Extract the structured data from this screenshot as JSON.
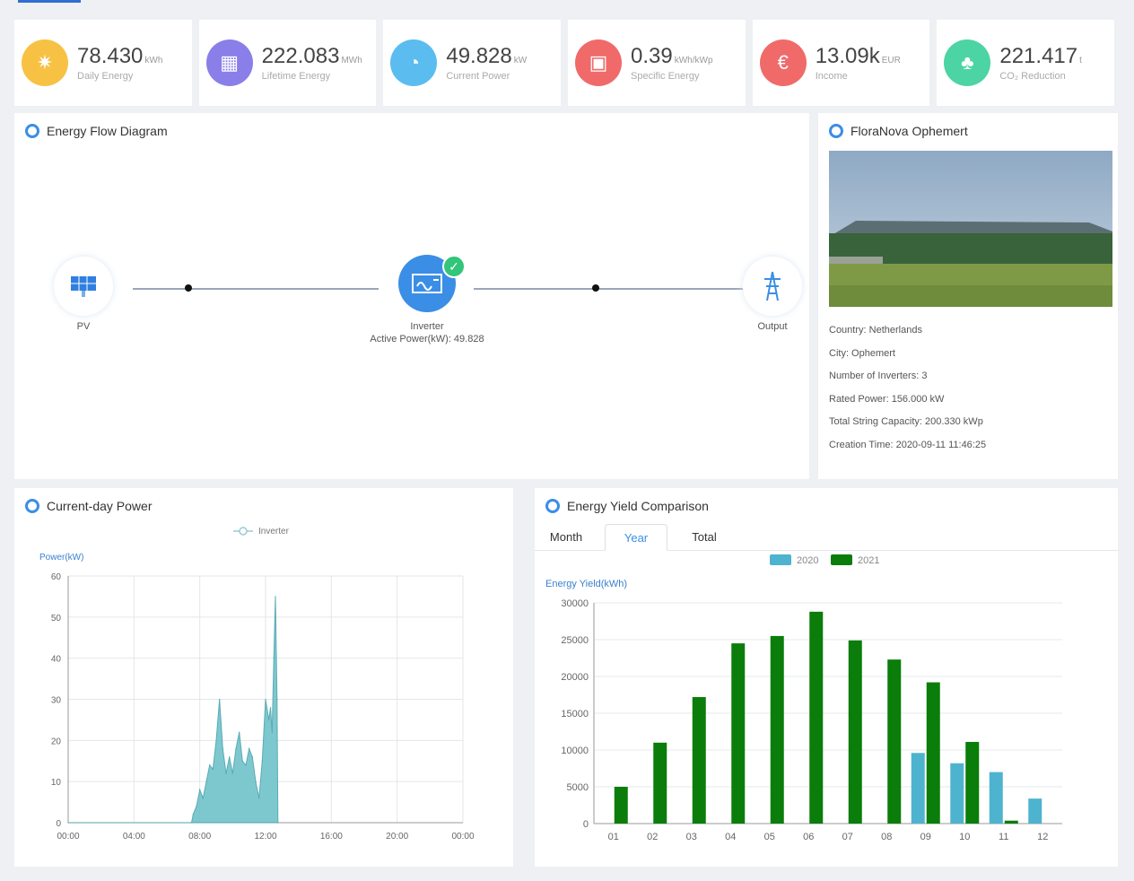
{
  "kpis": [
    {
      "value": "78.430",
      "unit": "kWh",
      "label": "Daily Energy",
      "color": "#f7c244",
      "icon": "sun-icon",
      "glyph": "✷"
    },
    {
      "value": "222.083",
      "unit": "MWh",
      "label": "Lifetime Energy",
      "color": "#8a7fe8",
      "icon": "battery-icon",
      "glyph": "▦"
    },
    {
      "value": "49.828",
      "unit": "kW",
      "label": "Current Power",
      "color": "#5bbcf0",
      "icon": "gauge-icon",
      "glyph": "◔"
    },
    {
      "value": "0.39",
      "unit": "kWh/kWp",
      "label": "Specific Energy",
      "color": "#f06a6a",
      "icon": "calendar-icon",
      "glyph": "▣"
    },
    {
      "value": "13.09k",
      "unit": "EUR",
      "label": "Income",
      "color": "#f06a6a",
      "icon": "money-icon",
      "glyph": "€"
    },
    {
      "value": "221.417",
      "unit": "t",
      "label": "CO₂ Reduction",
      "color": "#4cd4a4",
      "icon": "tree-icon",
      "glyph": "♣"
    }
  ],
  "flow": {
    "title": "Energy Flow Diagram",
    "pv_label": "PV",
    "inverter_label": "Inverter",
    "inverter_power": "Active Power(kW): 49.828",
    "output_label": "Output"
  },
  "plant": {
    "title": "FloraNova Ophemert",
    "country": "Country: Netherlands",
    "city": "City: Ophemert",
    "inverters": "Number of Inverters: 3",
    "rated_power": "Rated Power: 156.000 kW",
    "string_capacity": "Total String Capacity: 200.330 kWp",
    "creation_time": "Creation Time: 2020-09-11 11:46:25"
  },
  "power_chart": {
    "title": "Current-day Power",
    "legend": "Inverter",
    "color": "#6fc3c9"
  },
  "yield_chart": {
    "title": "Energy Yield Comparison",
    "tabs": [
      "Month",
      "Year",
      "Total"
    ],
    "active_tab": "Year"
  },
  "chart_data": [
    {
      "type": "area",
      "title": "Current-day Power",
      "ylabel": "Power(kW)",
      "ylim": [
        0,
        60
      ],
      "yticks": [
        "0",
        "10",
        "20",
        "30",
        "40",
        "50",
        "60"
      ],
      "xticks": [
        "00:00",
        "04:00",
        "08:00",
        "12:00",
        "16:00",
        "20:00",
        "00:00"
      ],
      "series": [
        {
          "name": "Inverter",
          "x": [
            0,
            7.5,
            7.6,
            7.8,
            8.0,
            8.2,
            8.4,
            8.6,
            8.8,
            9.0,
            9.2,
            9.4,
            9.6,
            9.8,
            10.0,
            10.2,
            10.4,
            10.6,
            10.8,
            11.0,
            11.2,
            11.4,
            11.6,
            11.8,
            12.0,
            12.2,
            12.3,
            12.4,
            12.5,
            12.6,
            12.7,
            12.75
          ],
          "y": [
            0,
            0,
            2,
            4,
            8,
            6,
            10,
            14,
            13,
            20,
            30,
            18,
            12,
            16,
            12,
            18,
            22,
            15,
            14,
            18,
            16,
            10,
            6,
            15,
            30,
            25,
            28,
            22,
            40,
            55,
            30,
            0
          ]
        }
      ]
    },
    {
      "type": "bar",
      "title": "Energy Yield Comparison",
      "ylabel": "Energy Yield(kWh)",
      "ylim": [
        0,
        30000
      ],
      "yticks": [
        "0",
        "5000",
        "10000",
        "15000",
        "20000",
        "25000",
        "30000"
      ],
      "categories": [
        "01",
        "02",
        "03",
        "04",
        "05",
        "06",
        "07",
        "08",
        "09",
        "10",
        "11",
        "12"
      ],
      "series": [
        {
          "name": "2020",
          "color": "#4eb3cf",
          "values": [
            0,
            0,
            0,
            0,
            0,
            0,
            0,
            0,
            9600,
            8200,
            7000,
            3400
          ]
        },
        {
          "name": "2021",
          "color": "#0a7d0a",
          "values": [
            5000,
            11000,
            17200,
            24500,
            25500,
            28800,
            24900,
            22300,
            19200,
            11100,
            400,
            0
          ]
        }
      ]
    }
  ]
}
